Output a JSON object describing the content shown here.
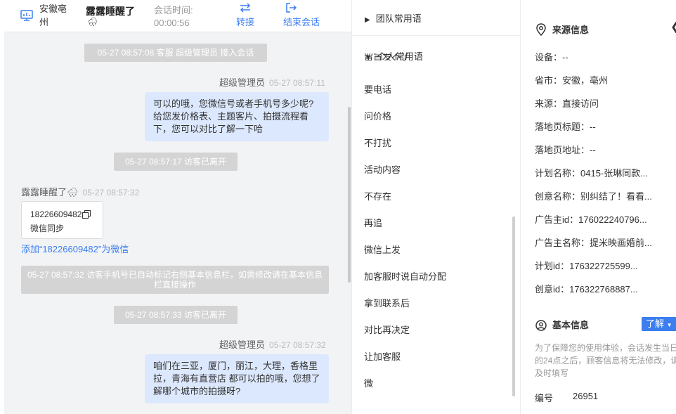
{
  "header": {
    "location": "安徽亳州",
    "visitor_name": "露露睡醒了",
    "weather_emoji": "🌧",
    "session_time_label": "会话时间:",
    "session_time": "00:00:56",
    "transfer_label": "转接",
    "end_label": "结束会话"
  },
  "messages": {
    "sys1": "05-27 08:57:08 客服 超级管理员 接入会话",
    "agent1_name": "超级管理员",
    "agent1_time": "05-27 08:57:11",
    "agent1_text": "可以的哦，您微信号或者手机号多少呢?给您发价格表、主题客片、拍摄流程看下，您可以对比了解一下哈",
    "sys2": "05-27 08:57:17 访客已离开",
    "visitor_name": "露露睡醒了🌧",
    "visitor_time": "05-27 08:57:32",
    "card_number": "18226609482",
    "card_sub": "微信同步",
    "add_wechat_link": "添加“18226609482”为微信",
    "sys3": "05-27 08:57:32 访客手机号已自动标记右侧基本信息栏，如需修改请在基本信息栏直接操作",
    "sys4": "05-27 08:57:33 访客已离开",
    "agent2_name": "超级管理员",
    "agent2_time": "05-27 08:57:32",
    "agent2_text": "咱们在三亚，厦门，丽江，大理，香格里拉，青海有直营店 都可以拍的哦，您想了解哪个城市的拍摄呀?"
  },
  "phrases": {
    "team_group": "团队常用语",
    "personal_group": "个人常用语",
    "cut_item": "留旨发不了",
    "items": [
      "要电话",
      "问价格",
      "不打扰",
      "活动内容",
      "不存在",
      "再追",
      "微信上发",
      "加客服时说自动分配",
      "拿到联系后",
      "对比再决定",
      "让加客服",
      "微"
    ]
  },
  "info": {
    "source_title": "来源信息",
    "rows": [
      "设备：--",
      "省市：安徽，亳州",
      "来源：直接访问",
      "落地页标题：--",
      "落地页地址：--",
      "计划名称：0415-张琳同款...",
      "创意名称：别纠结了！看看...",
      "广告主id：176022240796...",
      "广告主名称：提米映画婚前...",
      "计划id：176322725599...",
      "创意id：176322768887..."
    ],
    "basic_title": "基本信息",
    "learn_label": "了解",
    "notice": "为了保障您的使用体验，会话发生当日的24点之后，顾客信息将无法修改，请及时填写",
    "id_label": "编号",
    "id_value": "26951"
  },
  "colors": {
    "accent": "#3a7ef0",
    "agent_bubble": "#dce8fd",
    "system_pill": "#d4d4d4",
    "chat_bg": "#f2f3f5"
  }
}
